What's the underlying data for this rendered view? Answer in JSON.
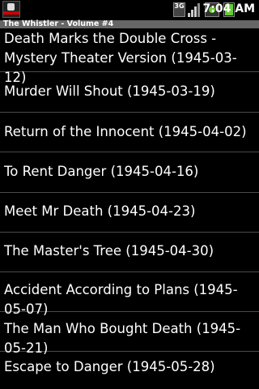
{
  "status_bar": {
    "network_label": "3G",
    "time": "7:04 AM"
  },
  "title_bar": {
    "title": "The Whistler - Volume #4"
  },
  "episodes": [
    {
      "title": "Death Marks the Double Cross - Mystery Theater Version (1945-03-12)"
    },
    {
      "title": "Murder Will Shout (1945-03-19)"
    },
    {
      "title": "Return of the Innocent (1945-04-02)"
    },
    {
      "title": "To Rent Danger (1945-04-16)"
    },
    {
      "title": "Meet Mr Death (1945-04-23)"
    },
    {
      "title": "The Master's Tree (1945-04-30)"
    },
    {
      "title": "Accident According to Plans (1945-05-07)"
    },
    {
      "title": "The Man Who Bought Death (1945-05-21)"
    },
    {
      "title": "Escape to Danger (1945-05-28)"
    }
  ]
}
